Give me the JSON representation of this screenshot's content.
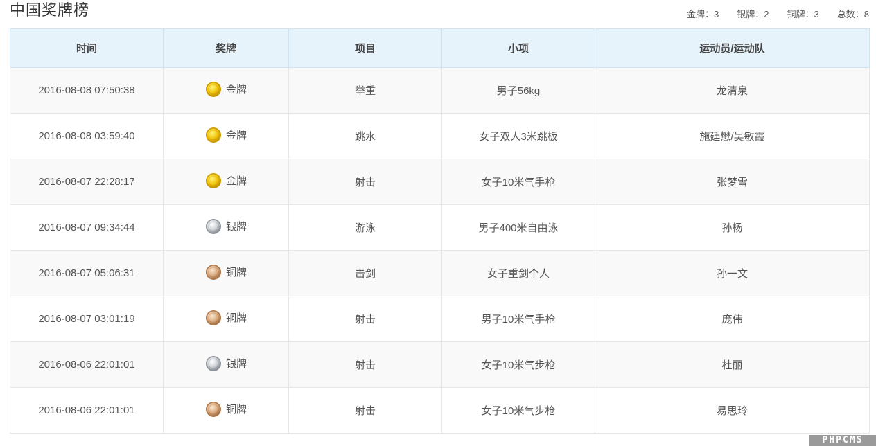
{
  "header": {
    "title": "中国奖牌榜",
    "stats": [
      {
        "label": "金牌",
        "value": "3"
      },
      {
        "label": "银牌",
        "value": "2"
      },
      {
        "label": "铜牌",
        "value": "3"
      },
      {
        "label": "总数",
        "value": "8"
      }
    ],
    "separator": "："
  },
  "table": {
    "columns": [
      "时间",
      "奖牌",
      "项目",
      "小项",
      "运动员/运动队"
    ],
    "rows": [
      {
        "time": "2016-08-08 07:50:38",
        "medal": "金牌",
        "medal_type": "gold",
        "sport": "举重",
        "event": "男子56kg",
        "athlete": "龙清泉"
      },
      {
        "time": "2016-08-08 03:59:40",
        "medal": "金牌",
        "medal_type": "gold",
        "sport": "跳水",
        "event": "女子双人3米跳板",
        "athlete": "施廷懋/吴敏霞"
      },
      {
        "time": "2016-08-07 22:28:17",
        "medal": "金牌",
        "medal_type": "gold",
        "sport": "射击",
        "event": "女子10米气手枪",
        "athlete": "张梦雪"
      },
      {
        "time": "2016-08-07 09:34:44",
        "medal": "银牌",
        "medal_type": "silver",
        "sport": "游泳",
        "event": "男子400米自由泳",
        "athlete": "孙杨"
      },
      {
        "time": "2016-08-07 05:06:31",
        "medal": "铜牌",
        "medal_type": "bronze",
        "sport": "击剑",
        "event": "女子重剑个人",
        "athlete": "孙一文"
      },
      {
        "time": "2016-08-07 03:01:19",
        "medal": "铜牌",
        "medal_type": "bronze",
        "sport": "射击",
        "event": "男子10米气手枪",
        "athlete": "庞伟"
      },
      {
        "time": "2016-08-06 22:01:01",
        "medal": "银牌",
        "medal_type": "silver",
        "sport": "射击",
        "event": "女子10米气步枪",
        "athlete": "杜丽"
      },
      {
        "time": "2016-08-06 22:01:01",
        "medal": "铜牌",
        "medal_type": "bronze",
        "sport": "射击",
        "event": "女子10米气步枪",
        "athlete": "易思玲"
      }
    ]
  },
  "medal_colors": {
    "gold": {
      "light": "#fff27a",
      "mid": "#f2c811",
      "dark": "#c99700"
    },
    "silver": {
      "light": "#ffffff",
      "mid": "#cfd3d8",
      "dark": "#8e949b"
    },
    "bronze": {
      "light": "#fbe6cf",
      "mid": "#dcae83",
      "dark": "#a9764a"
    }
  },
  "watermark": "PHPCMS"
}
